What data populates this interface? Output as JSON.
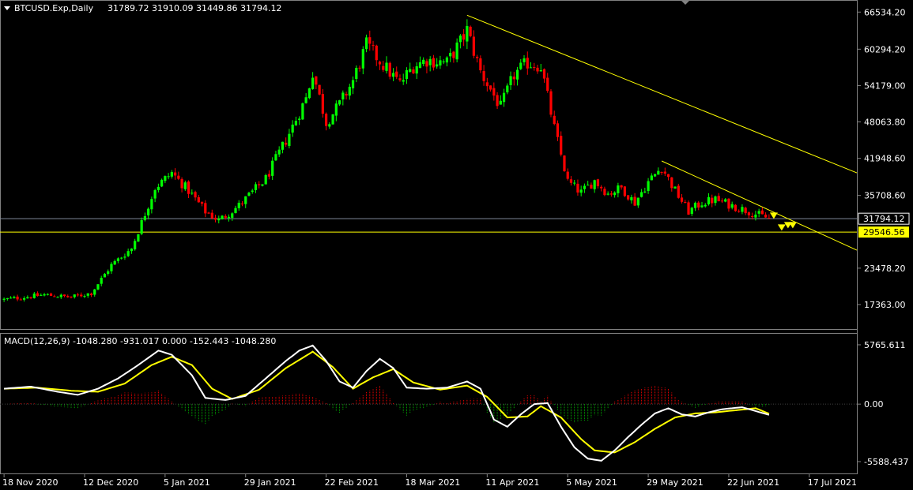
{
  "chart_data": [
    {
      "type": "candlestick",
      "title": "BTCUSD.Exp,Daily",
      "ohlc_label": "31789.72 31910.09 31449.86 31794.12",
      "x_labels": [
        "18 Nov 2020",
        "12 Dec 2020",
        "5 Jan 2021",
        "29 Jan 2021",
        "22 Feb 2021",
        "18 Mar 2021",
        "11 Apr 2021",
        "5 May 2021",
        "29 May 2021",
        "22 Jun 2021",
        "17 Jul 2021"
      ],
      "y_ticks": [
        "66534.20",
        "60294.20",
        "54179.00",
        "48063.80",
        "41948.60",
        "35708.60",
        "23478.20",
        "17363.00"
      ],
      "ylim": [
        15500,
        67500
      ],
      "current_price": "31794.12",
      "support_level": "29546.56",
      "up_color": "#00ff00",
      "down_color": "#ff0000",
      "trendline_color": "#ffff00",
      "close_anchors": [
        [
          0,
          18200
        ],
        [
          12,
          19000
        ],
        [
          20,
          18600
        ],
        [
          26,
          19300
        ],
        [
          32,
          24000
        ],
        [
          38,
          26800
        ],
        [
          45,
          37000
        ],
        [
          50,
          39500
        ],
        [
          55,
          36500
        ],
        [
          60,
          33000
        ],
        [
          64,
          31500
        ],
        [
          70,
          34000
        ],
        [
          78,
          38500
        ],
        [
          84,
          45000
        ],
        [
          90,
          52000
        ],
        [
          92,
          56500
        ],
        [
          96,
          48000
        ],
        [
          100,
          51000
        ],
        [
          104,
          55000
        ],
        [
          108,
          61000
        ],
        [
          114,
          57000
        ],
        [
          118,
          54500
        ],
        [
          122,
          57500
        ],
        [
          126,
          58500
        ],
        [
          132,
          58000
        ],
        [
          136,
          61500
        ],
        [
          138,
          63500
        ],
        [
          142,
          56500
        ],
        [
          148,
          50500
        ],
        [
          152,
          56000
        ],
        [
          156,
          58000
        ],
        [
          160,
          57500
        ],
        [
          164,
          47000
        ],
        [
          168,
          38000
        ],
        [
          172,
          36200
        ],
        [
          176,
          38200
        ],
        [
          180,
          36000
        ],
        [
          184,
          37000
        ],
        [
          188,
          34500
        ],
        [
          192,
          38000
        ],
        [
          196,
          40500
        ],
        [
          200,
          36500
        ],
        [
          204,
          33000
        ],
        [
          208,
          34500
        ],
        [
          212,
          35000
        ],
        [
          216,
          34200
        ],
        [
          222,
          33000
        ],
        [
          228,
          31800
        ]
      ]
    },
    {
      "type": "macd",
      "label": "MACD(12,26,9) -1048.280 -931.017 0.000 -152.443 -1048.280",
      "y_ticks": [
        "5765.611",
        "0.00",
        "-5588.437"
      ],
      "ylim": [
        -6200,
        6300
      ],
      "macd_color": "#ffffff",
      "signal_color": "#ffff00",
      "hist_pos_color": "#ff0000",
      "hist_neg_color": "#00b000",
      "macd_anchors": [
        [
          0,
          1500
        ],
        [
          8,
          1700
        ],
        [
          16,
          1200
        ],
        [
          22,
          900
        ],
        [
          28,
          1500
        ],
        [
          34,
          2500
        ],
        [
          40,
          3800
        ],
        [
          46,
          5200
        ],
        [
          50,
          4800
        ],
        [
          56,
          2800
        ],
        [
          60,
          600
        ],
        [
          66,
          400
        ],
        [
          72,
          800
        ],
        [
          78,
          2500
        ],
        [
          84,
          4200
        ],
        [
          88,
          5200
        ],
        [
          92,
          5700
        ],
        [
          96,
          4200
        ],
        [
          100,
          2200
        ],
        [
          104,
          1600
        ],
        [
          108,
          3200
        ],
        [
          112,
          4400
        ],
        [
          116,
          3500
        ],
        [
          120,
          1600
        ],
        [
          126,
          1500
        ],
        [
          132,
          1600
        ],
        [
          138,
          2200
        ],
        [
          142,
          1500
        ],
        [
          146,
          -1500
        ],
        [
          150,
          -2200
        ],
        [
          154,
          -1000
        ],
        [
          158,
          0
        ],
        [
          162,
          100
        ],
        [
          166,
          -2200
        ],
        [
          170,
          -4200
        ],
        [
          174,
          -5300
        ],
        [
          178,
          -5500
        ],
        [
          182,
          -4500
        ],
        [
          186,
          -3200
        ],
        [
          190,
          -2000
        ],
        [
          194,
          -900
        ],
        [
          198,
          -400
        ],
        [
          202,
          -1000
        ],
        [
          206,
          -1200
        ],
        [
          210,
          -800
        ],
        [
          214,
          -500
        ],
        [
          220,
          -300
        ],
        [
          228,
          -1048
        ]
      ],
      "signal_anchors": [
        [
          0,
          1500
        ],
        [
          10,
          1600
        ],
        [
          20,
          1300
        ],
        [
          28,
          1200
        ],
        [
          36,
          2000
        ],
        [
          44,
          3800
        ],
        [
          50,
          4600
        ],
        [
          56,
          3800
        ],
        [
          62,
          1500
        ],
        [
          68,
          500
        ],
        [
          76,
          1400
        ],
        [
          84,
          3500
        ],
        [
          92,
          5100
        ],
        [
          98,
          3600
        ],
        [
          104,
          1500
        ],
        [
          110,
          2600
        ],
        [
          116,
          3400
        ],
        [
          122,
          2100
        ],
        [
          130,
          1400
        ],
        [
          138,
          1800
        ],
        [
          144,
          700
        ],
        [
          150,
          -1300
        ],
        [
          156,
          -1200
        ],
        [
          160,
          -200
        ],
        [
          166,
          -1300
        ],
        [
          172,
          -3400
        ],
        [
          176,
          -4500
        ],
        [
          182,
          -4700
        ],
        [
          188,
          -3700
        ],
        [
          194,
          -2400
        ],
        [
          200,
          -1300
        ],
        [
          206,
          -900
        ],
        [
          212,
          -800
        ],
        [
          218,
          -600
        ],
        [
          224,
          -400
        ],
        [
          228,
          -931
        ]
      ]
    }
  ]
}
